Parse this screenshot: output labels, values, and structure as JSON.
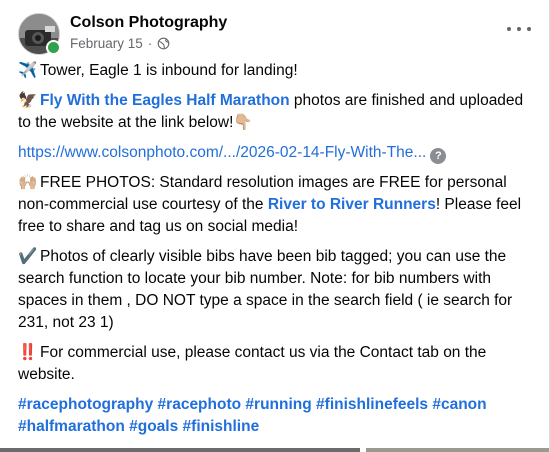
{
  "post": {
    "page_name": "Colson Photography",
    "date": "February 15",
    "separator": "·",
    "audience_icon": "globe-icon",
    "p1_emoji": "✈️",
    "p1_text": "Tower, Eagle 1 is inbound for landing!",
    "p2_emoji": "🦅",
    "p2_link": "Fly With the Eagles Half Marathon",
    "p2_text": " photos are finished and uploaded to the website at the link below!👇🏼",
    "url": "https://www.colsonphoto.com/.../2026-02-14-Fly-With-The...",
    "p3_emoji": "🙌🏼",
    "p3_text_a": "FREE PHOTOS: Standard resolution images are FREE for personal non-commercial use courtesy of the ",
    "p3_link": "River to River Runners",
    "p3_text_b": "! Please feel free to share and tag us on social media!",
    "p4_emoji": "✔️",
    "p4_text": "Photos of clearly visible bibs have been bib tagged; you can use the search function to locate your bib number. Note: for bib numbers with spaces in them , DO NOT type a space in the search field ( ie search for 231, not 23 1)",
    "p5_emoji": "‼️",
    "p5_text": "For commercial use, please contact us via the Contact tab on the website.",
    "hashtags": [
      "#racephotography",
      "#racephoto",
      "#running",
      "#finishlinefeels",
      "#canon",
      "#halfmarathon",
      "#goals",
      "#finishline"
    ]
  },
  "colors": {
    "link": "#216fdb",
    "meta": "#65676b",
    "online": "#31a24c"
  }
}
